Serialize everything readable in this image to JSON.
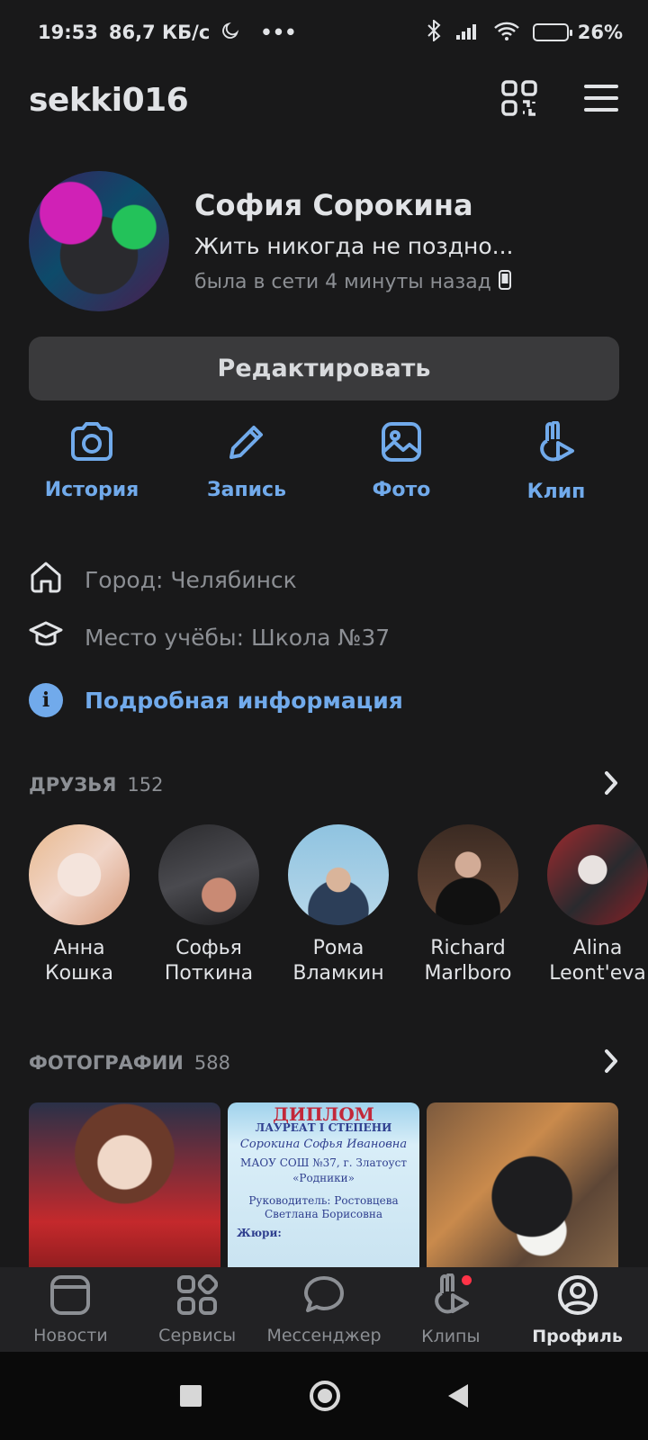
{
  "status_bar": {
    "time": "19:53",
    "speed": "86,7 КБ/с",
    "more": "•••",
    "battery_level": 0.26,
    "battery_text": "26%"
  },
  "header": {
    "username": "sekki016"
  },
  "profile": {
    "name": "София Сорокина",
    "status": "Жить никогда не поздно...",
    "online": "была в сети 4 минуты назад"
  },
  "edit_button": "Редактировать",
  "actions": [
    {
      "label": "История",
      "icon": "camera-icon"
    },
    {
      "label": "Запись",
      "icon": "pencil-icon"
    },
    {
      "label": "Фото",
      "icon": "image-icon"
    },
    {
      "label": "Клип",
      "icon": "clip-icon"
    }
  ],
  "info": {
    "city": "Город: Челябинск",
    "school": "Место учёбы: Школа №37",
    "more": "Подробная информация"
  },
  "friends": {
    "title": "ДРУЗЬЯ",
    "count": "152",
    "items": [
      {
        "first": "Анна",
        "last": "Кошка"
      },
      {
        "first": "Софья",
        "last": "Поткина"
      },
      {
        "first": "Рома",
        "last": "Вламкин"
      },
      {
        "first": "Richard",
        "last": "Marlboro"
      },
      {
        "first": "Alina",
        "last": "Leont'eva"
      }
    ]
  },
  "photos": {
    "title": "ФОТОГРАФИИ",
    "count": "588",
    "diploma_lines": [
      "ДИПЛОМ",
      "ЛАУРЕАТ I СТЕПЕНИ",
      "Сорокина Софья Ивановна",
      "МАОУ СОШ №37, г. Златоуст",
      "«Родники»",
      "Руководитель: Ростовцева Светлана Борисовна",
      "Жюри:"
    ]
  },
  "bottom_nav": [
    {
      "label": "Новости",
      "icon": "news-icon"
    },
    {
      "label": "Сервисы",
      "icon": "services-icon"
    },
    {
      "label": "Мессенджер",
      "icon": "messenger-icon"
    },
    {
      "label": "Клипы",
      "icon": "clips-icon"
    },
    {
      "label": "Профиль",
      "icon": "profile-icon"
    }
  ],
  "colors": {
    "accent": "#71aaeb",
    "background": "#19191a",
    "button": "#3a3a3c",
    "nav_badge": "#ff3347"
  }
}
